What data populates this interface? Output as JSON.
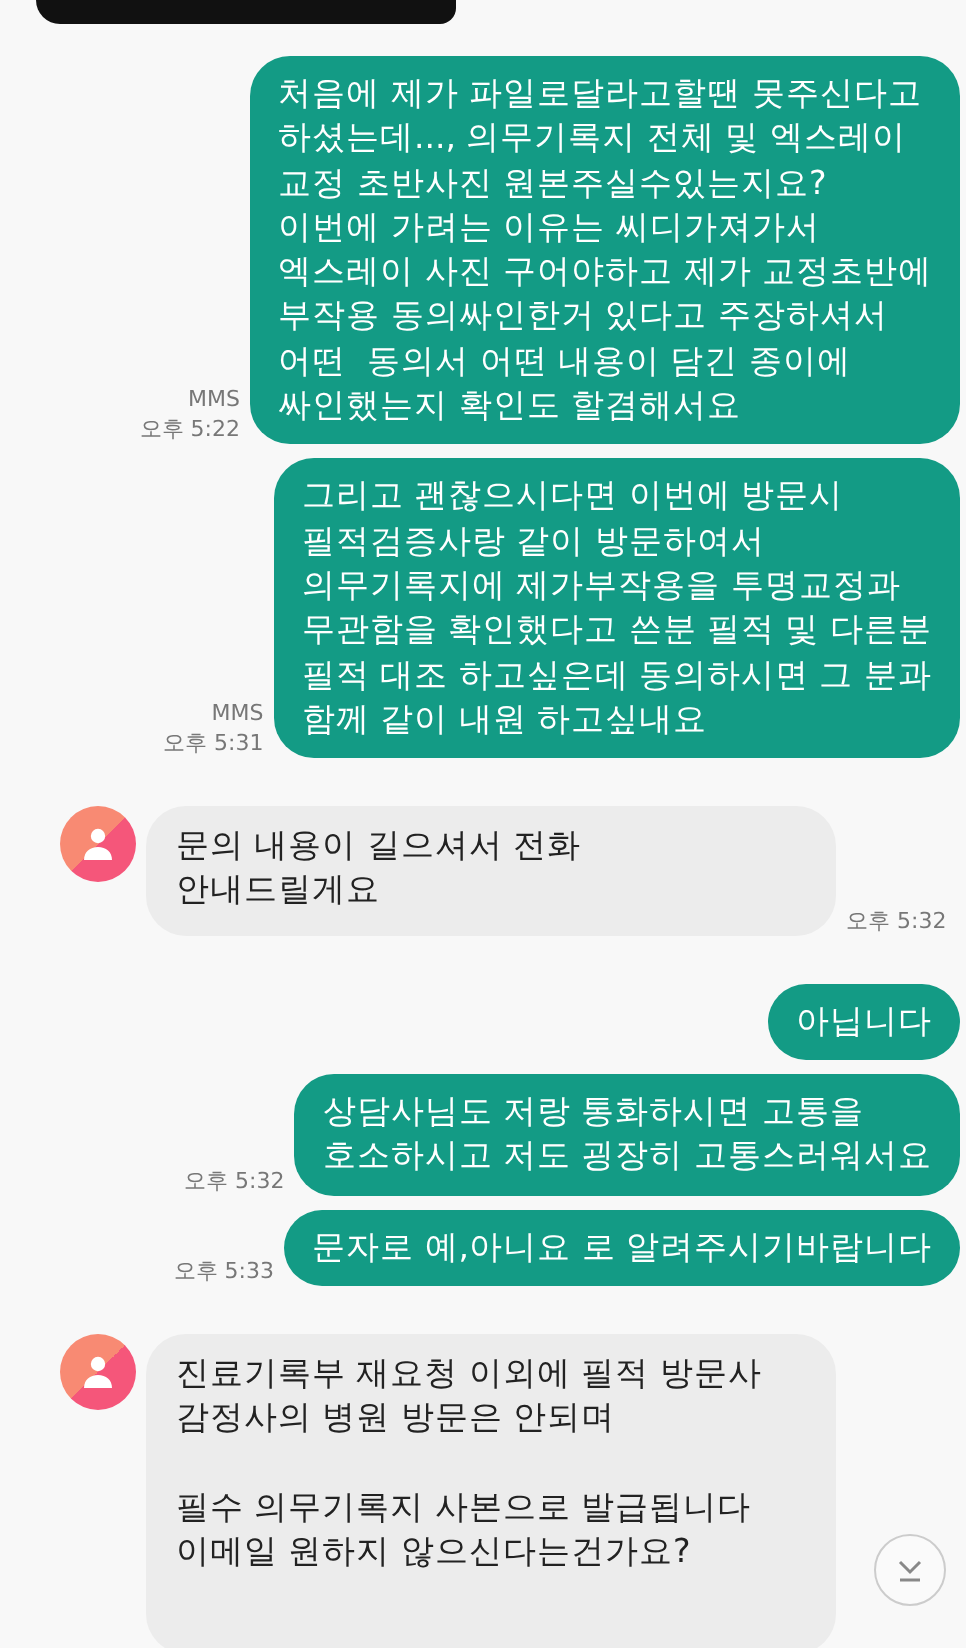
{
  "messages": [
    {
      "kind": "sent",
      "text": "처음에 제가 파일로달라고할땐 못주신다고\n하셨는데..., 의무기록지 전체 및 엑스레이\n교정 초반사진 원본주실수있는지요?\n이번에 가려는 이유는 씨디가져가서\n엑스레이 사진 구어야하고 제가 교정초반에\n부작용 동의싸인한거 있다고 주장하셔서\n어떤  동의서 어떤 내용이 담긴 종이에\n싸인했는지 확인도 할겸해서요",
      "label": "MMS",
      "time": "오후 5:22"
    },
    {
      "kind": "sent",
      "text": "그리고 괜찮으시다면 이번에 방문시\n필적검증사랑 같이 방문하여서\n의무기록지에 제가부작용을 투명교정과\n무관함을 확인했다고 쓴분 필적 및 다른분\n필적 대조 하고싶은데 동의하시면 그 분과\n함께 같이 내원 하고싶내요",
      "label": "MMS",
      "time": "오후 5:31"
    },
    {
      "kind": "received",
      "text": "문의 내용이 길으셔서 전화\n안내드릴게요",
      "time": "오후 5:32"
    },
    {
      "kind": "sent",
      "text": "아닙니다"
    },
    {
      "kind": "sent",
      "text": "상담사님도 저랑 통화하시면 고통을\n호소하시고 저도 굉장히 고통스러워서요",
      "time": "오후 5:32"
    },
    {
      "kind": "sent",
      "text": "문자로 예,아니요 로 알려주시기바랍니다",
      "time": "오후 5:33"
    },
    {
      "kind": "received",
      "text": "진료기록부 재요청 이외에 필적 방문사\n감정사의 병원 방문은 안되며\n\n필수 의무기록지 사본으로 발급됩니다\n이메일 원하지 않으신다는건가요?"
    }
  ]
}
